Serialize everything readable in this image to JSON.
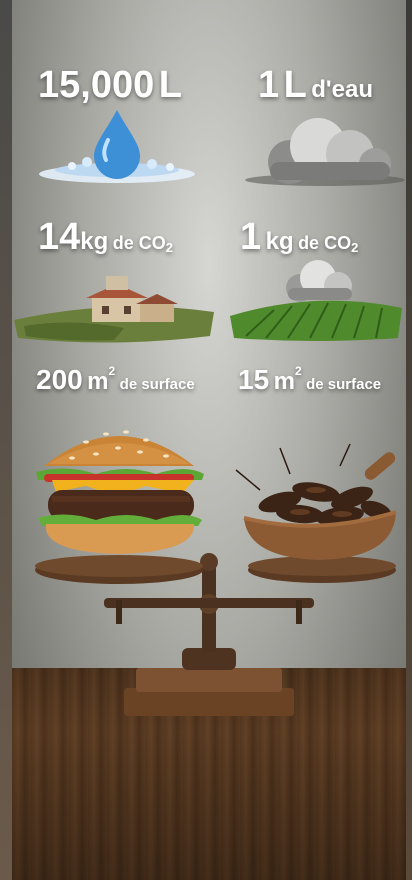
{
  "stats": {
    "beef_water": {
      "value": "15,000",
      "unit": "L"
    },
    "insect_water": {
      "value": "1",
      "unit": "L",
      "suffix": "d'eau"
    },
    "beef_co2": {
      "value": "14",
      "unit": "kg",
      "suffix": "de CO",
      "sub": "2"
    },
    "insect_co2": {
      "value": "1",
      "unit": "kg",
      "suffix": "de CO",
      "sub": "2"
    },
    "beef_surface": {
      "value": "200",
      "unit": "m",
      "sup": "2",
      "suffix": "de surface"
    },
    "insect_surface": {
      "value": "15",
      "unit": "m",
      "sup": "2",
      "suffix": "de surface"
    }
  },
  "icons": [
    "water-drop-icon",
    "cloud-icon",
    "farmhouse-icon",
    "crop-field-cloud-icon",
    "burger-icon",
    "crickets-bowl-icon",
    "balance-scale-icon"
  ],
  "colors": {
    "background": "#a9a9a4",
    "text": "#ffffff",
    "wood": "#6e4828",
    "water": "#3d8fd6"
  }
}
